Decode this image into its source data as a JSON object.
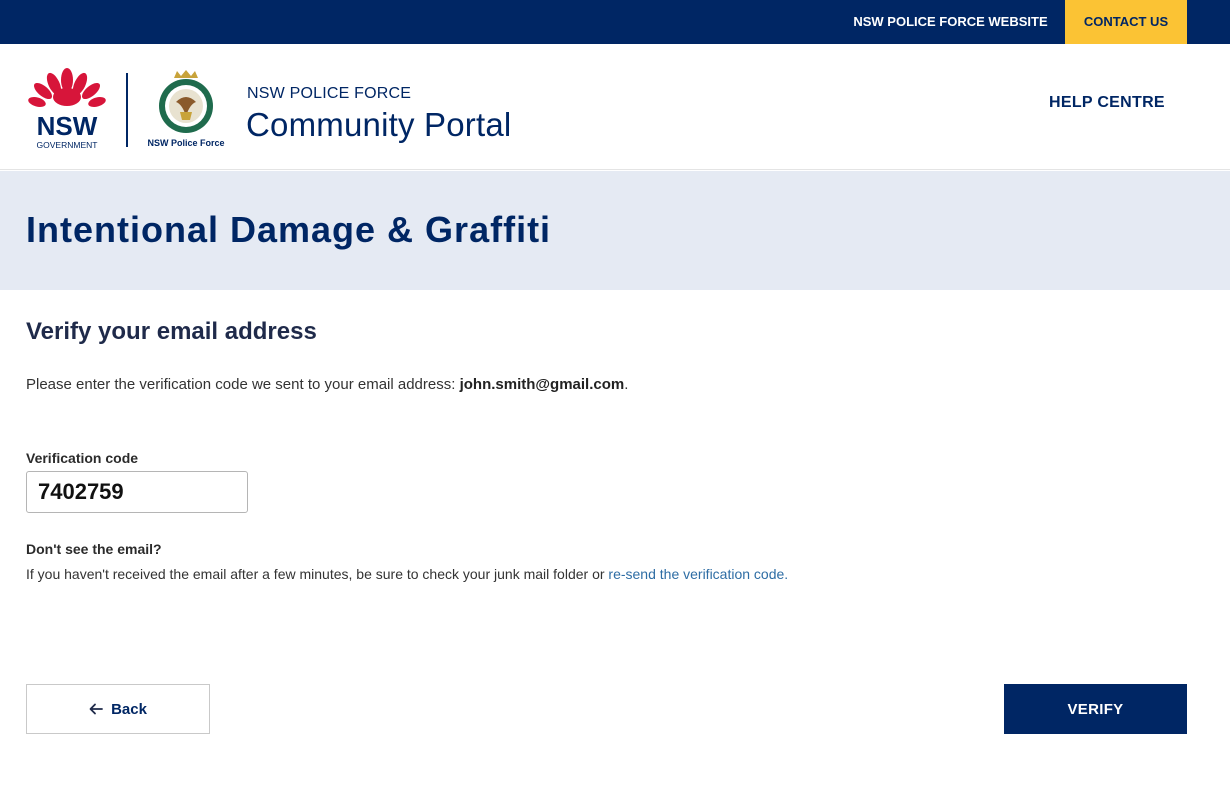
{
  "topbar": {
    "website_link": "NSW POLICE FORCE WEBSITE",
    "contact_link": "CONTACT US"
  },
  "header": {
    "nsw_logo_text": "NSW",
    "nsw_logo_subtext": "GOVERNMENT",
    "crest_caption": "NSW Police Force",
    "brand_small": "NSW POLICE FORCE",
    "brand_large": "Community Portal",
    "help_link": "HELP CENTRE"
  },
  "banner": {
    "title": "Intentional Damage & Graffiti"
  },
  "verify": {
    "title": "Verify your email address",
    "intro_prefix": "Please enter the verification code we sent to your email address: ",
    "email": "john.smith@gmail.com",
    "intro_suffix": ".",
    "code_label": "Verification code",
    "code_value": "7402759",
    "hint_title": "Don't see the email?",
    "hint_text": "If you haven't received the email after a few minutes, be sure to check your junk mail folder or ",
    "resend_link": "re-send the verification code."
  },
  "actions": {
    "back_label": "Back",
    "verify_label": "VERIFY"
  },
  "colors": {
    "navy": "#002664",
    "accent_yellow": "#fbc334",
    "nsw_red": "#d7153a",
    "banner_bg": "#e5eaf3",
    "link_blue": "#2e6da4"
  }
}
